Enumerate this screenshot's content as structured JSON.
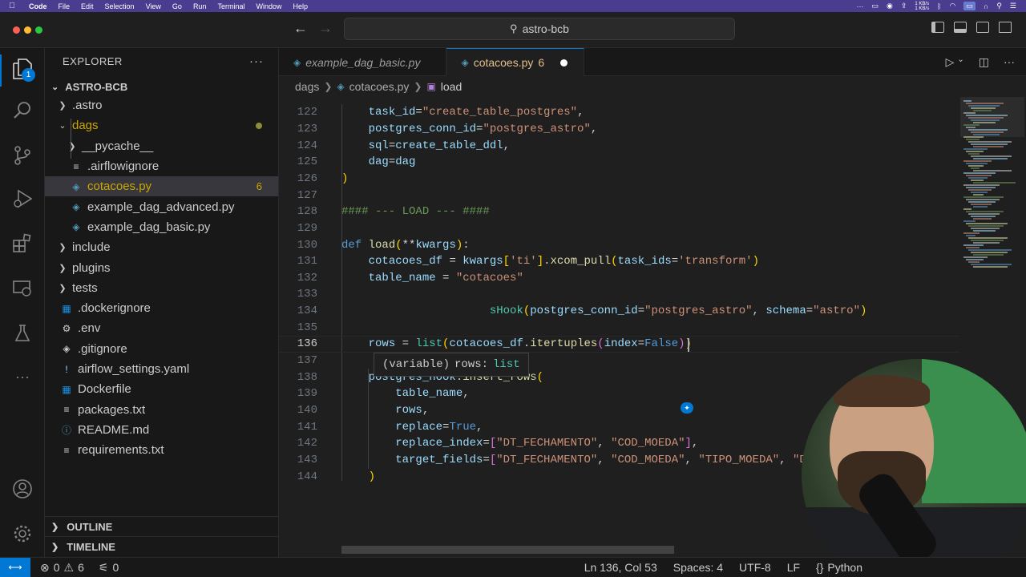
{
  "menubar": {
    "app": "Code",
    "items": [
      "File",
      "Edit",
      "Selection",
      "View",
      "Go",
      "Run",
      "Terminal",
      "Window",
      "Help"
    ],
    "net_up": "1 KB/s",
    "net_down": "1 KB/s"
  },
  "titlebar": {
    "search": "astro-bcb"
  },
  "activitybar": {
    "explorer_badge": "1"
  },
  "sidebar": {
    "header": "EXPLORER",
    "more": "···",
    "root": "ASTRO-BCB",
    "items": [
      {
        "label": ".astro",
        "type": "folder",
        "indent": 1,
        "open": false
      },
      {
        "label": "dags",
        "type": "folder",
        "indent": 1,
        "open": true,
        "warn": true
      },
      {
        "label": "__pycache__",
        "type": "folder",
        "indent": 2,
        "open": false
      },
      {
        "label": ".airflowignore",
        "type": "lines",
        "indent": 2
      },
      {
        "label": "cotacoes.py",
        "type": "py",
        "indent": 2,
        "selected": true,
        "count": "6",
        "warn": true
      },
      {
        "label": "example_dag_advanced.py",
        "type": "py",
        "indent": 2
      },
      {
        "label": "example_dag_basic.py",
        "type": "py",
        "indent": 2
      },
      {
        "label": "include",
        "type": "folder",
        "indent": 1,
        "open": false
      },
      {
        "label": "plugins",
        "type": "folder",
        "indent": 1,
        "open": false
      },
      {
        "label": "tests",
        "type": "folder",
        "indent": 1,
        "open": false
      },
      {
        "label": ".dockerignore",
        "type": "docker",
        "indent": 1
      },
      {
        "label": ".env",
        "type": "gear",
        "indent": 1
      },
      {
        "label": ".gitignore",
        "type": "git",
        "indent": 1
      },
      {
        "label": "airflow_settings.yaml",
        "type": "yaml",
        "indent": 1
      },
      {
        "label": "Dockerfile",
        "type": "docker",
        "indent": 1
      },
      {
        "label": "packages.txt",
        "type": "lines",
        "indent": 1
      },
      {
        "label": "README.md",
        "type": "info",
        "indent": 1
      },
      {
        "label": "requirements.txt",
        "type": "lines",
        "indent": 1
      }
    ],
    "outline": "OUTLINE",
    "timeline": "TIMELINE"
  },
  "tabs": [
    {
      "label": "example_dag_basic.py",
      "active": false
    },
    {
      "label": "cotacoes.py",
      "active": true,
      "count": "6",
      "dirty": true
    }
  ],
  "breadcrumb": [
    "dags",
    "cotacoes.py",
    "load"
  ],
  "code": {
    "current_line": 136,
    "lines": [
      {
        "n": 122,
        "html": "    <span class='var'>task_id</span><span class='op'>=</span><span class='str'>\"create_table_postgres\"</span>,"
      },
      {
        "n": 123,
        "html": "    <span class='var'>postgres_conn_id</span><span class='op'>=</span><span class='str'>\"postgres_astro\"</span>,"
      },
      {
        "n": 124,
        "html": "    <span class='var'>sql</span><span class='op'>=</span><span class='var'>create_table_ddl</span>,"
      },
      {
        "n": 125,
        "html": "    <span class='var'>dag</span><span class='op'>=</span><span class='var'>dag</span>"
      },
      {
        "n": 126,
        "html": "<span class='par'>)</span>"
      },
      {
        "n": 127,
        "html": ""
      },
      {
        "n": 128,
        "html": "<span class='cmt'>#### --- LOAD --- ####</span>"
      },
      {
        "n": 129,
        "html": ""
      },
      {
        "n": 130,
        "html": "<span class='kw'>def</span> <span class='fn'>load</span><span class='par'>(</span><span class='op'>**</span><span class='var'>kwargs</span><span class='par'>)</span>:"
      },
      {
        "n": 131,
        "html": "    <span class='var'>cotacoes_df</span> <span class='op'>=</span> <span class='var'>kwargs</span><span class='par'>[</span><span class='str'>'ti'</span><span class='par'>]</span>.<span class='fn'>xcom_pull</span><span class='par'>(</span><span class='var'>task_ids</span><span class='op'>=</span><span class='str'>'transform'</span><span class='par'>)</span>"
      },
      {
        "n": 132,
        "html": "    <span class='var'>table_name</span> <span class='op'>=</span> <span class='str'>\"cotacoes\"</span>"
      },
      {
        "n": 133,
        "html": ""
      },
      {
        "n": 134,
        "html": "                      <span class='cls'>sHook</span><span class='par'>(</span><span class='var'>postgres_conn_id</span><span class='op'>=</span><span class='str'>\"postgres_astro\"</span>, <span class='var'>schema</span><span class='op'>=</span><span class='str'>\"astro\"</span><span class='par'>)</span>"
      },
      {
        "n": 135,
        "html": ""
      },
      {
        "n": 136,
        "html": "    <span class='var'>rows</span> <span class='op'>=</span> <span class='cls'>list</span><span class='par'>(</span><span class='var'>cotacoes_df</span>.<span class='fn'>itertuples</span><span class='par2'>(</span><span class='var'>index</span><span class='op'>=</span><span class='bool'>False</span><span class='par2'>)</span><span class='par'>)</span>"
      },
      {
        "n": 137,
        "html": ""
      },
      {
        "n": 138,
        "html": "    <span class='var'>postgres_hook</span>.<span class='fn'>insert_rows</span><span class='par'>(</span>"
      },
      {
        "n": 139,
        "html": "        <span class='var'>table_name</span>,"
      },
      {
        "n": 140,
        "html": "        <span class='var'>rows</span>,"
      },
      {
        "n": 141,
        "html": "        <span class='var'>replace</span><span class='op'>=</span><span class='bool'>True</span>,"
      },
      {
        "n": 142,
        "html": "        <span class='var'>replace_index</span><span class='op'>=</span><span class='par2'>[</span><span class='str'>\"DT_FECHAMENTO\"</span>, <span class='str'>\"COD_MOEDA\"</span><span class='par2'>]</span>,"
      },
      {
        "n": 143,
        "html": "        <span class='var'>target_fields</span><span class='op'>=</span><span class='par2'>[</span><span class='str'>\"DT_FECHAMENTO\"</span>, <span class='str'>\"COD_MOEDA\"</span>, <span class='str'>\"TIPO_MOEDA\"</span>, <span class='str'>\"DE</span>"
      },
      {
        "n": 144,
        "html": "    <span class='par'>)</span>"
      }
    ]
  },
  "hover": {
    "kind": "(variable)",
    "name": "rows:",
    "type": "list"
  },
  "statusbar": {
    "errors": "0",
    "warnings": "6",
    "ports": "0",
    "position": "Ln 136, Col 53",
    "spaces": "Spaces: 4",
    "encoding": "UTF-8",
    "eol": "LF",
    "language": "Python"
  }
}
